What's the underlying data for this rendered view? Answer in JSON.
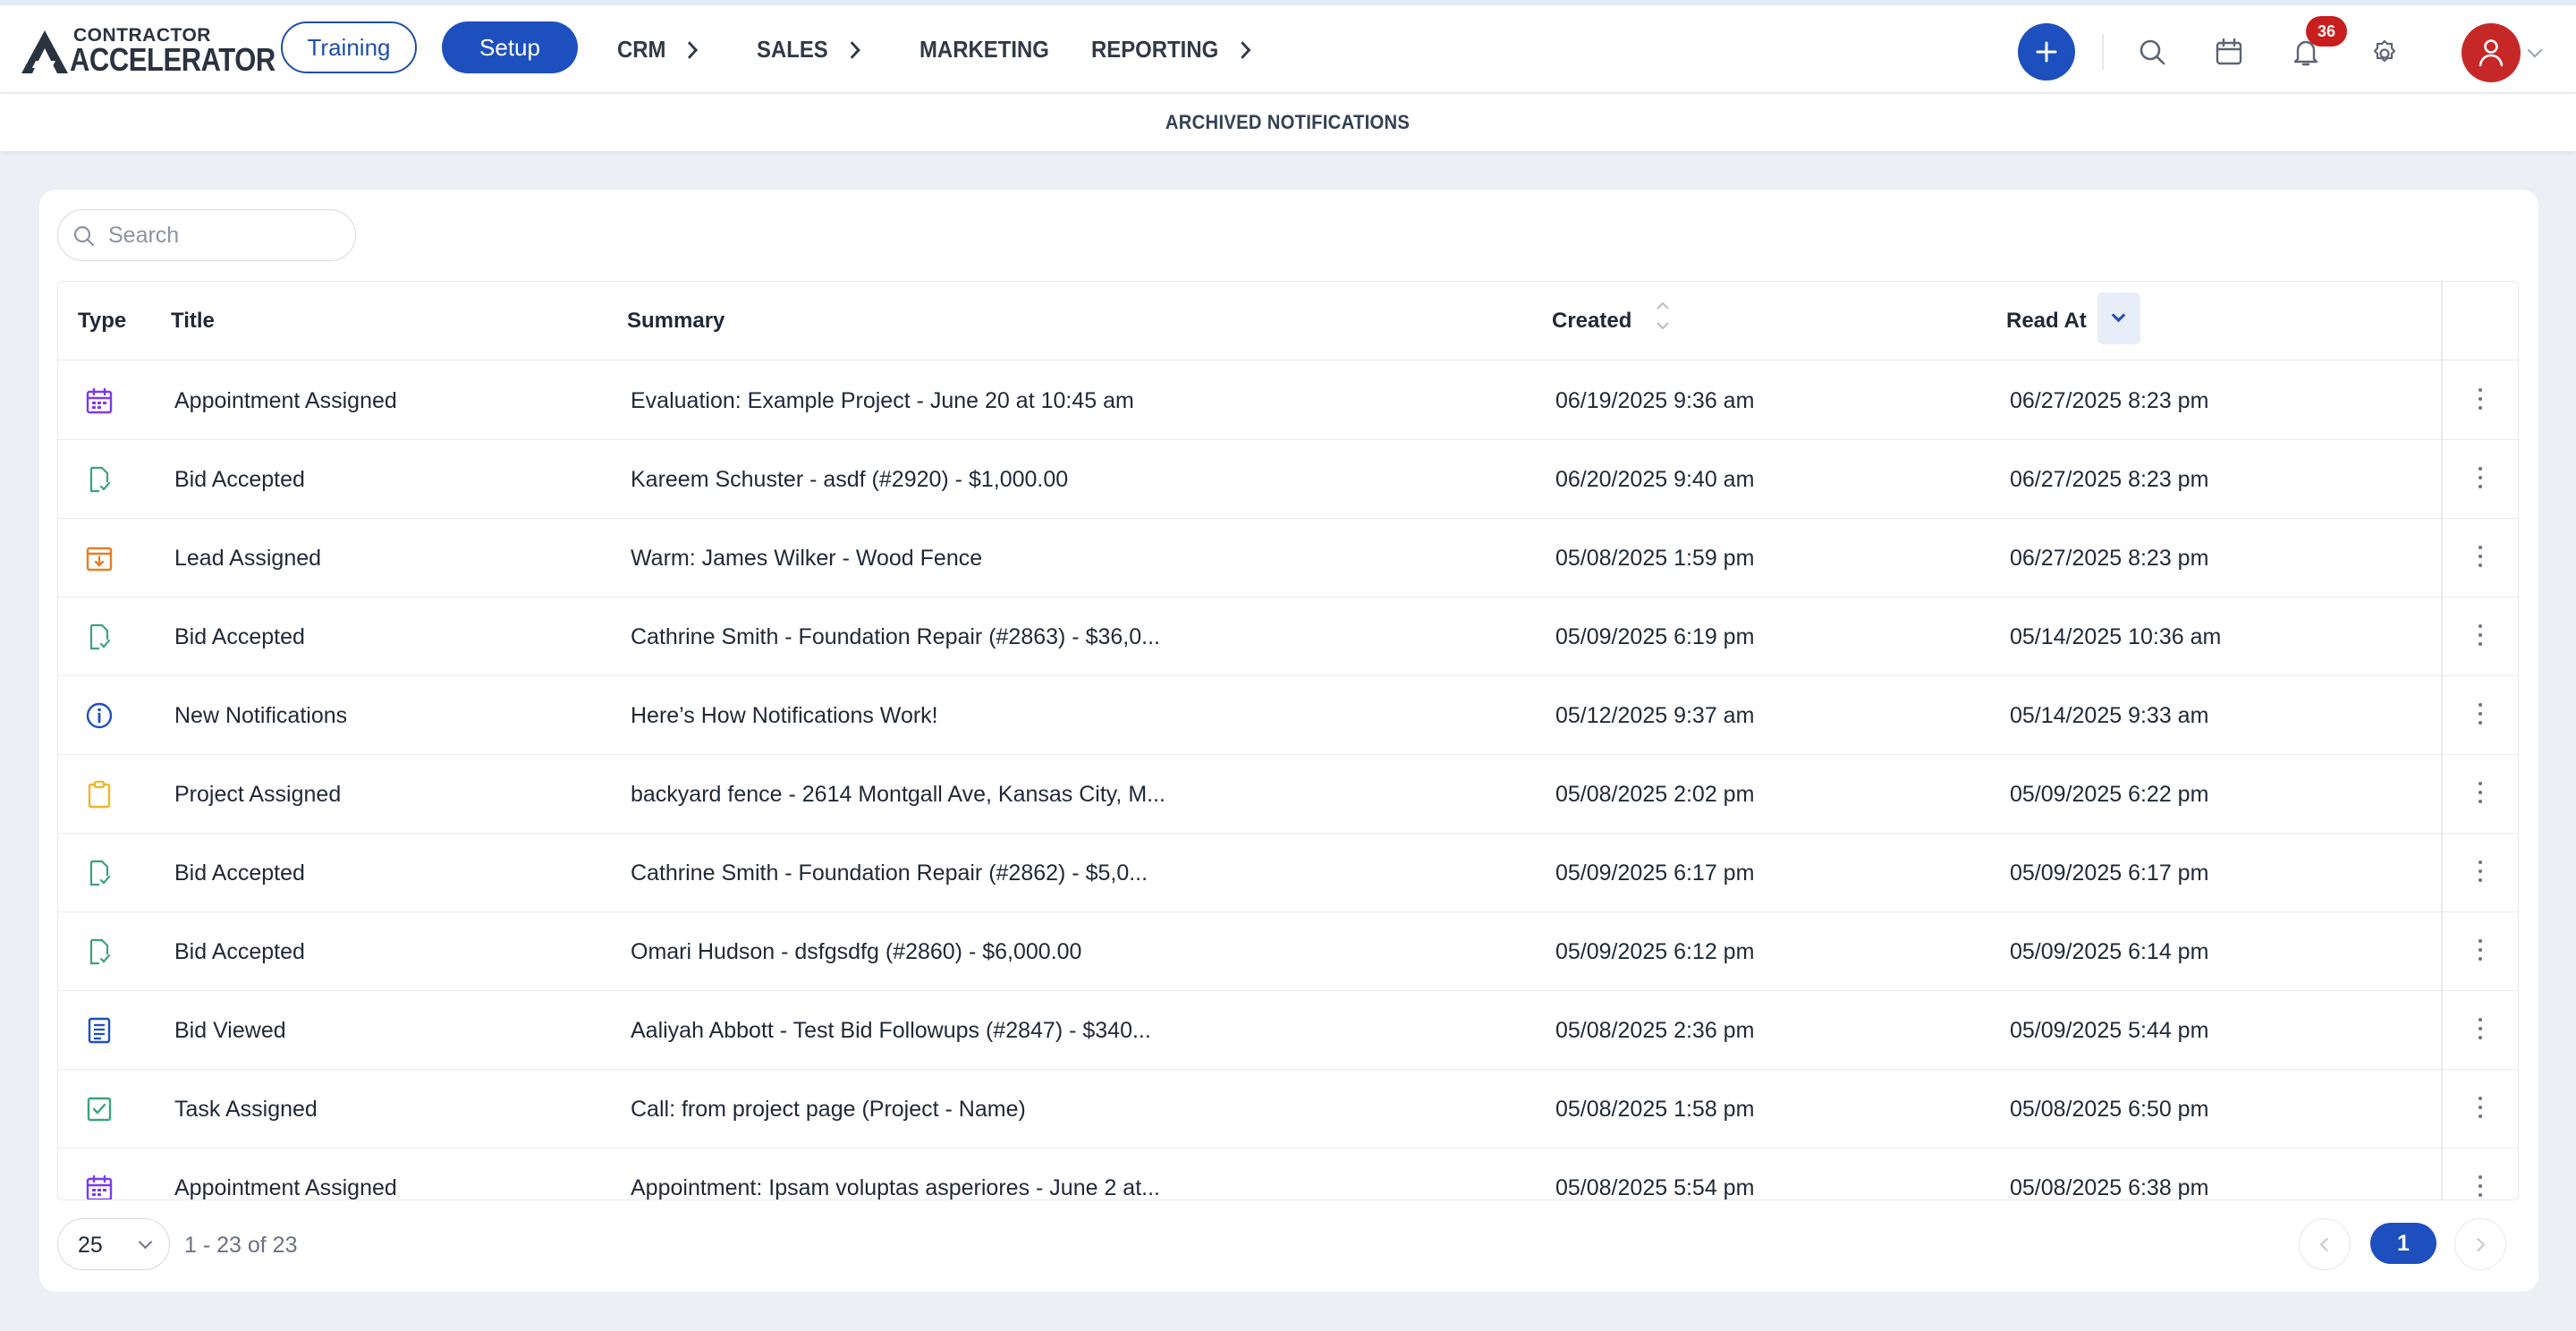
{
  "brand": {
    "line1": "CONTRACTOR",
    "line2": "ACCELERATOR"
  },
  "nav": {
    "training": "Training",
    "setup": "Setup",
    "items": [
      "CRM",
      "SALES",
      "MARKETING",
      "REPORTING"
    ]
  },
  "header": {
    "notification_count": "36"
  },
  "page": {
    "title": "ARCHIVED NOTIFICATIONS"
  },
  "search": {
    "placeholder": "Search",
    "value": ""
  },
  "table": {
    "headers": {
      "type": "Type",
      "title": "Title",
      "summary": "Summary",
      "created": "Created",
      "read_at": "Read At"
    },
    "rows": [
      {
        "icon": "calendar-icon",
        "title": "Appointment Assigned",
        "summary": "Evaluation: Example Project - June 20 at 10:45 am",
        "created": "06/19/2025 9:36 am",
        "read_at": "06/27/2025 8:23 pm"
      },
      {
        "icon": "document-check-icon",
        "title": "Bid Accepted",
        "summary": "Kareem Schuster - asdf (#2920) - $1,000.00",
        "created": "06/20/2025 9:40 am",
        "read_at": "06/27/2025 8:23 pm"
      },
      {
        "icon": "inbox-download-icon",
        "title": "Lead Assigned",
        "summary": "Warm: James Wilker - Wood Fence",
        "created": "05/08/2025 1:59 pm",
        "read_at": "06/27/2025 8:23 pm"
      },
      {
        "icon": "document-check-icon",
        "title": "Bid Accepted",
        "summary": "Cathrine Smith - Foundation Repair (#2863) - $36,0...",
        "created": "05/09/2025 6:19 pm",
        "read_at": "05/14/2025 10:36 am"
      },
      {
        "icon": "info-icon",
        "title": "New Notifications",
        "summary": "Here’s How Notifications Work!",
        "created": "05/12/2025 9:37 am",
        "read_at": "05/14/2025 9:33 am"
      },
      {
        "icon": "clipboard-icon",
        "title": "Project Assigned",
        "summary": "backyard fence - 2614 Montgall Ave, Kansas City, M...",
        "created": "05/08/2025 2:02 pm",
        "read_at": "05/09/2025 6:22 pm"
      },
      {
        "icon": "document-check-icon",
        "title": "Bid Accepted",
        "summary": "Cathrine Smith - Foundation Repair (#2862) - $5,0...",
        "created": "05/09/2025 6:17 pm",
        "read_at": "05/09/2025 6:17 pm"
      },
      {
        "icon": "document-check-icon",
        "title": "Bid Accepted",
        "summary": "Omari Hudson - dsfgsdfg (#2860) - $6,000.00",
        "created": "05/09/2025 6:12 pm",
        "read_at": "05/09/2025 6:14 pm"
      },
      {
        "icon": "document-lines-icon",
        "title": "Bid Viewed",
        "summary": "Aaliyah Abbott - Test Bid Followups (#2847) - $340...",
        "created": "05/08/2025 2:36 pm",
        "read_at": "05/09/2025 5:44 pm"
      },
      {
        "icon": "checkbox-icon",
        "title": "Task Assigned",
        "summary": "Call: from project page (Project - Name)",
        "created": "05/08/2025 1:58 pm",
        "read_at": "05/08/2025 6:50 pm"
      },
      {
        "icon": "calendar-icon",
        "title": "Appointment Assigned",
        "summary": "Appointment: Ipsam voluptas asperiores - June 2 at...",
        "created": "05/08/2025 5:54 pm",
        "read_at": "05/08/2025 6:38 pm"
      }
    ]
  },
  "pagination": {
    "page_size": "25",
    "range": "1 - 23 of 23",
    "current_page": "1"
  },
  "colors": {
    "primary": "#1e4fbf",
    "badge": "#c81e1e",
    "avatar": "#c62828",
    "calendar": "#7c3aed",
    "bid": "#3aa37a",
    "lead": "#e67e22",
    "info": "#1e4fbf",
    "project": "#f0b429",
    "task": "#3aa37a"
  }
}
